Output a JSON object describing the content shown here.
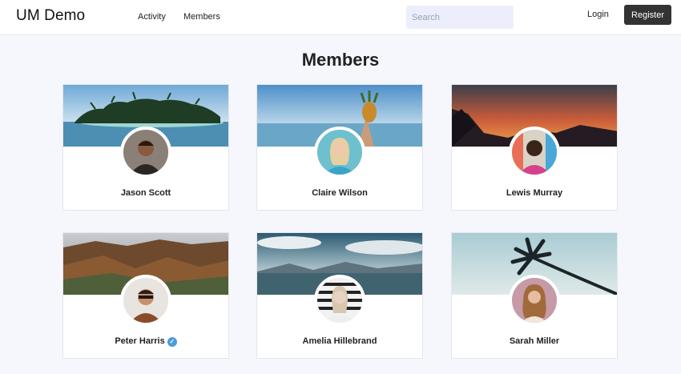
{
  "header": {
    "logo": "UM Demo",
    "nav": [
      {
        "label": "Activity"
      },
      {
        "label": "Members"
      }
    ],
    "search_placeholder": "Search",
    "login_label": "Login",
    "register_label": "Register"
  },
  "page": {
    "title": "Members"
  },
  "members": [
    {
      "name": "Jason Scott",
      "verified": false,
      "cover": "tropical-island"
    },
    {
      "name": "Claire Wilson",
      "verified": false,
      "cover": "pineapple-sea"
    },
    {
      "name": "Lewis Murray",
      "verified": false,
      "cover": "sunset-mountains"
    },
    {
      "name": "Peter Harris",
      "verified": true,
      "verified_icon": "verified-check-icon",
      "cover": "canyon"
    },
    {
      "name": "Amelia Hillebrand",
      "verified": false,
      "cover": "lake-mountains"
    },
    {
      "name": "Sarah Miller",
      "verified": false,
      "cover": "palm-tree-sky"
    }
  ],
  "colors": {
    "accent": "#333333",
    "background": "#f5f7fc",
    "verified": "#4a9cdb"
  }
}
